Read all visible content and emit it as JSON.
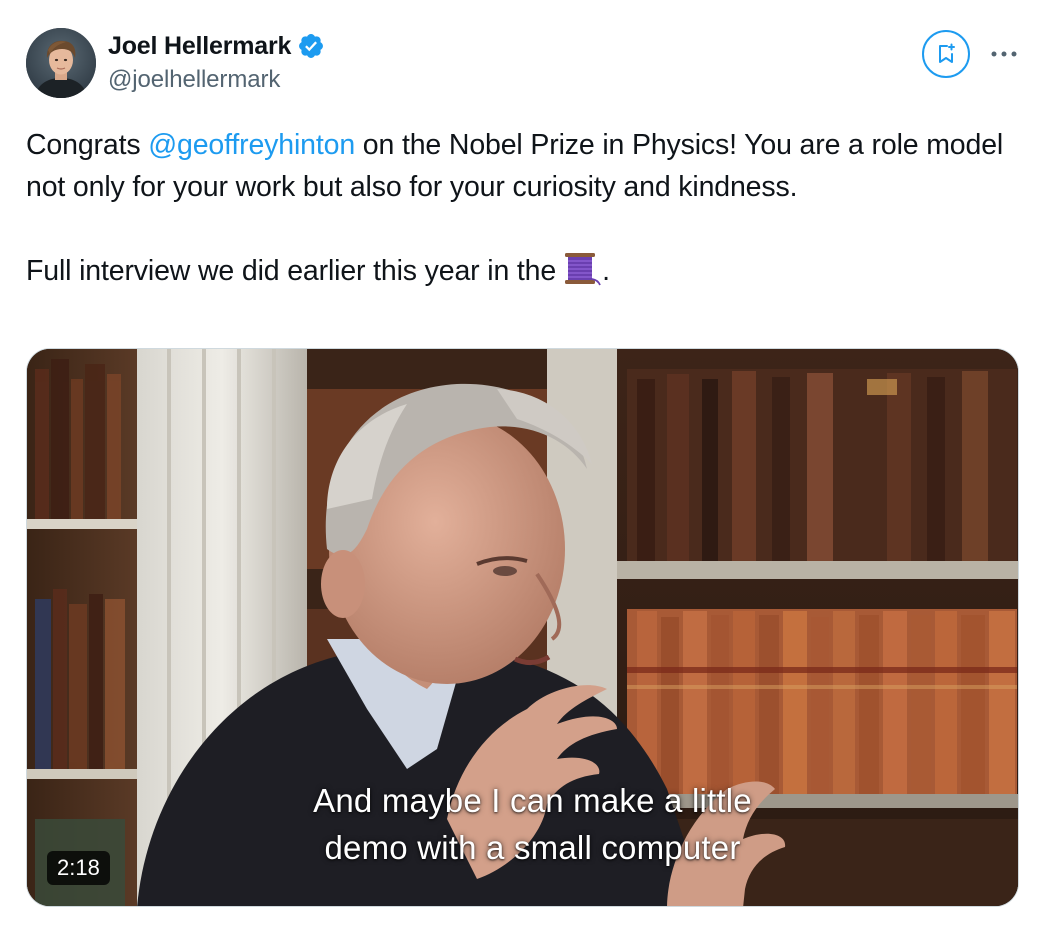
{
  "author": {
    "display_name": "Joel Hellermark",
    "handle": "@joelhellermark",
    "verified": true,
    "verified_icon": "verified-badge-icon",
    "avatar_icon": "avatar"
  },
  "actions": {
    "grok_icon": "grok-icon",
    "more_icon": "more-options-icon"
  },
  "tweet": {
    "text_before_mention": "Congrats ",
    "mention": "@geoffreyhinton",
    "text_after_mention": " on the Nobel Prize in Physics! You are a role model not only for your work but also for your curiosity and kindness.",
    "second_paragraph": "Full interview we did earlier this year in the",
    "second_paragraph_end": ".",
    "emoji": "thread-spool-emoji"
  },
  "video": {
    "caption_line1": "And maybe I can make a little",
    "caption_line2": "demo with a small computer",
    "duration": "2:18"
  },
  "colors": {
    "accent": "#1d9bf0",
    "text": "#0f1419",
    "secondary_text": "#536471",
    "verified_badge": "#1d9bf0"
  }
}
